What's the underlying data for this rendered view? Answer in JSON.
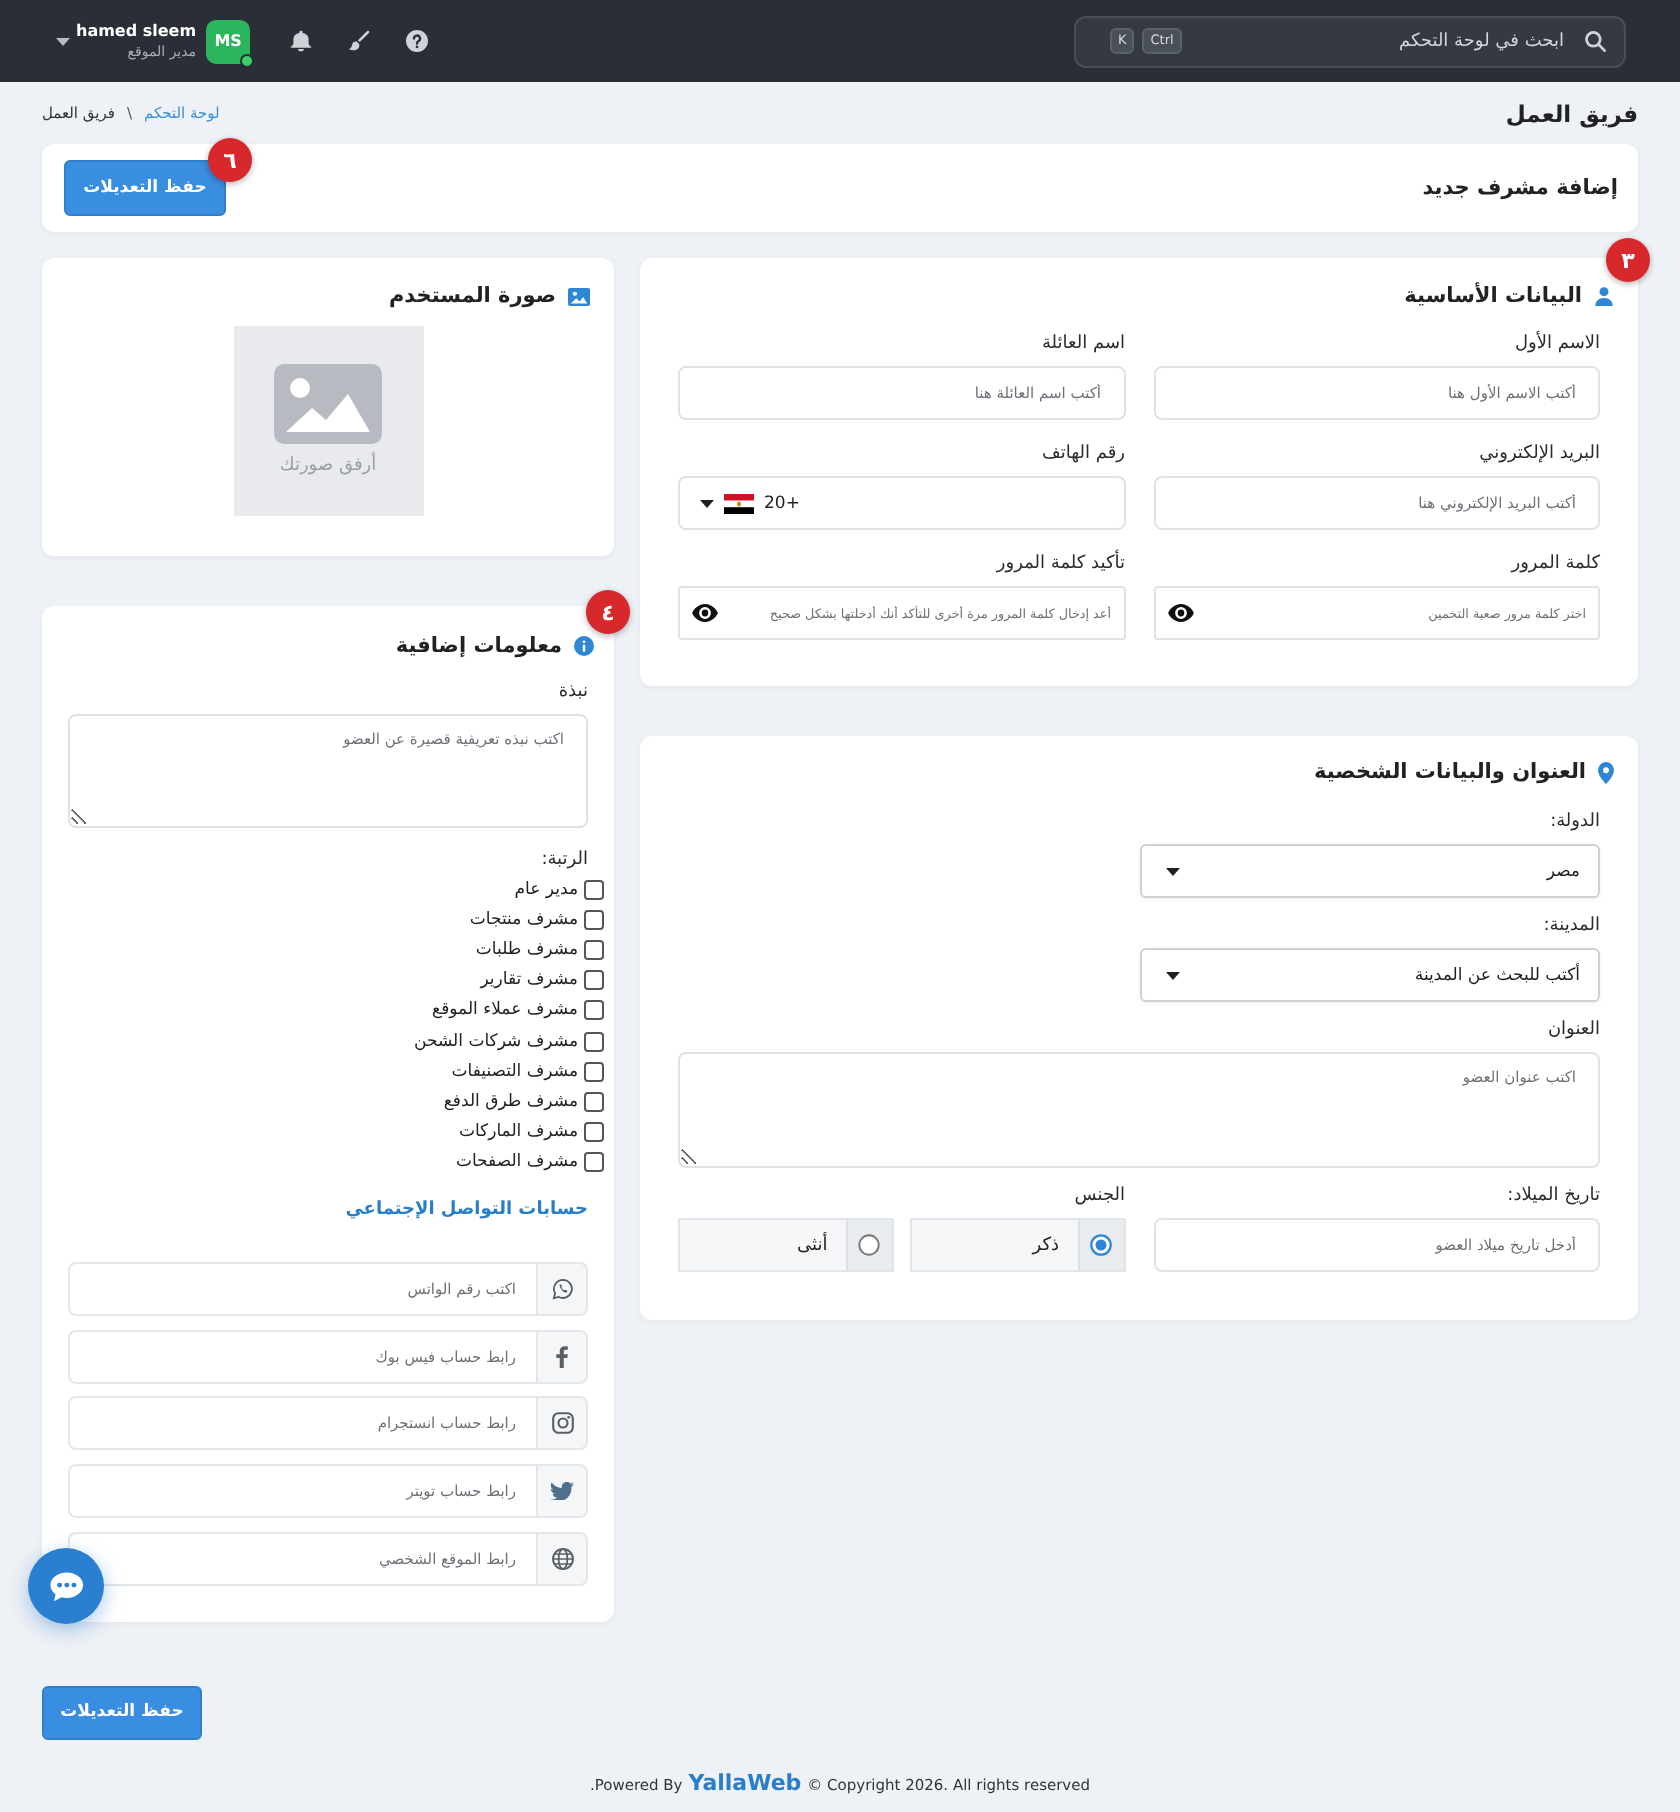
{
  "topbar": {
    "search": {
      "placeholder": "ابحث في لوحة التحكم",
      "shortcut": [
        "Ctrl",
        "K"
      ]
    },
    "user": {
      "initials": "MS",
      "name": "hamed sleem",
      "role": "مدير الموقع",
      "online": true
    }
  },
  "page": {
    "title": "فريق العمل",
    "breadcrumb": [
      {
        "label": "لوحة التحكم",
        "kind": "link"
      },
      {
        "label": "فريق العمل",
        "kind": "current"
      }
    ],
    "breadcrumb_separator": "\\"
  },
  "header": {
    "title": "إضافة مشرف جديد",
    "save_button": "حفظ التعديلات",
    "badge": "٦"
  },
  "basic_info": {
    "title": "البيانات الأساسية",
    "badge": "٣",
    "fields": [
      {
        "kind": "text",
        "label": "الاسم الأول",
        "placeholder": "أكتب الاسم الأول هنا"
      },
      {
        "kind": "text",
        "label": "اسم العائلة",
        "placeholder": "أكتب اسم العائلة هنا"
      },
      {
        "kind": "text",
        "label": "البريد الإلكتروني",
        "placeholder": "أكتب البريد الإلكتروني هنا"
      },
      {
        "kind": "phone",
        "label": "رقم الهاتف",
        "value": "+20"
      },
      {
        "kind": "password",
        "label": "كلمة المرور",
        "placeholder": "اختر كلمة مرور صعبة التخمين"
      },
      {
        "kind": "password",
        "label": "تأكيد كلمة المرور",
        "placeholder": "أعد إدخال كلمة المرور مرة أخرى للتأكد أنك أدخلتها بشكل صحيح"
      }
    ]
  },
  "address": {
    "title": "العنوان والبيانات الشخصية",
    "fields": [
      {
        "kind": "select",
        "label": "الدولة:",
        "value": "مصر"
      },
      {
        "kind": "select",
        "label": "المدينة:",
        "value": "أكتب للبحث عن المدينة"
      },
      {
        "kind": "textarea",
        "label": "العنوان",
        "placeholder": "اكتب عنوان العضو"
      },
      {
        "kind": "text",
        "label": "تاريخ الميلاد:",
        "placeholder": "أدخل تاريخ ميلاد العضو"
      },
      {
        "kind": "radio",
        "label": "الجنس",
        "options": [
          {
            "label": "ذكر",
            "selected": true
          },
          {
            "label": "أنثى",
            "selected": false
          }
        ]
      }
    ]
  },
  "photo": {
    "title": "صورة المستخدم",
    "upload_hint": "أرفق صورتك"
  },
  "additional_info": {
    "title": "معلومات إضافية",
    "badge": "٤",
    "bio": {
      "label": "نبذة",
      "placeholder": "اكتب نبذه تعريفية قصيرة عن العضو"
    },
    "roles": {
      "label": "الرتبة:",
      "options": [
        {
          "label": "مدير عام",
          "checked": false
        },
        {
          "label": "مشرف منتجات",
          "checked": false
        },
        {
          "label": "مشرف طلبات",
          "checked": false
        },
        {
          "label": "مشرف تقارير",
          "checked": false
        },
        {
          "label": "مشرف عملاء الموقع",
          "checked": false
        },
        {
          "label": "مشرف شركات الشحن",
          "checked": false
        },
        {
          "label": "مشرف التصنيفات",
          "checked": false
        },
        {
          "label": "مشرف طرق الدفع",
          "checked": false
        },
        {
          "label": "مشرف الماركات",
          "checked": false
        },
        {
          "label": "مشرف الصفحات",
          "checked": false
        }
      ]
    },
    "social": {
      "title": "حسابات التواصل الإجتماعي",
      "links": [
        {
          "kind": "whatsapp",
          "placeholder": "اكتب رقم الواتس"
        },
        {
          "kind": "facebook",
          "placeholder": "رابط حساب فيس بوك"
        },
        {
          "kind": "instagram",
          "placeholder": "رابط حساب انستجرام"
        },
        {
          "kind": "twitter",
          "placeholder": "رابط حساب تويتر"
        },
        {
          "kind": "website",
          "placeholder": "رابط الموقع الشخصي"
        }
      ]
    }
  },
  "save_button": "حفظ التعديلات",
  "footer": {
    "prefix": ".Powered By",
    "brand": "YallaWeb",
    "suffix": "© Copyright 2026. All rights reserved"
  }
}
